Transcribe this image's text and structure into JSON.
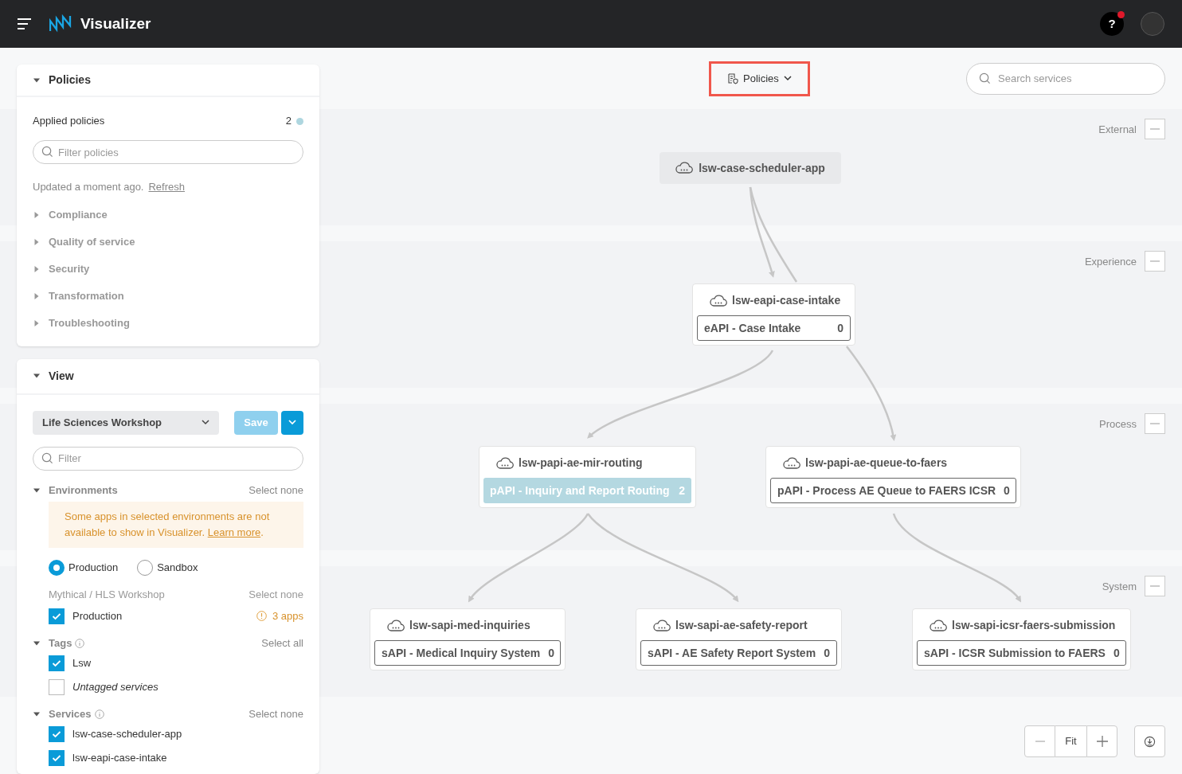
{
  "header": {
    "title": "Visualizer",
    "help_label": "?",
    "help_notification": true
  },
  "policies_panel": {
    "title": "Policies",
    "expanded": true,
    "applied_label": "Applied policies",
    "applied_count": "2",
    "filter_placeholder": "Filter policies",
    "updated_text": "Updated a moment ago.",
    "refresh_link": "Refresh",
    "categories": [
      {
        "label": "Compliance",
        "expanded": false
      },
      {
        "label": "Quality of service",
        "expanded": false
      },
      {
        "label": "Security",
        "expanded": false
      },
      {
        "label": "Transformation",
        "expanded": false
      },
      {
        "label": "Troubleshooting",
        "expanded": false
      }
    ]
  },
  "view_panel": {
    "title": "View",
    "expanded": true,
    "view_select": "Life Sciences Workshop",
    "save_button": {
      "label": "Save",
      "disabled": true
    },
    "filter_placeholder": "Filter",
    "environments": {
      "title": "Environments",
      "expanded": true,
      "action": "Select none",
      "notice": {
        "text": "Some apps in selected environments are not available to show in Visualizer.",
        "link": "Learn more",
        "suffix": "."
      },
      "types": [
        {
          "label": "Production",
          "selected": true
        },
        {
          "label": "Sandbox",
          "selected": false
        }
      ],
      "group": {
        "title": "Mythical / HLS Workshop",
        "action": "Select none",
        "items": [
          {
            "label": "Production",
            "checked": true,
            "warning": "3 apps"
          }
        ]
      }
    },
    "tags": {
      "title": "Tags",
      "expanded": true,
      "action": "Select all",
      "items": [
        {
          "label": "Lsw",
          "checked": true,
          "kind": "tag"
        },
        {
          "label": "Untagged services",
          "checked": false,
          "kind": "untagged"
        }
      ]
    },
    "services": {
      "title": "Services",
      "expanded": true,
      "action": "Select none",
      "items": [
        {
          "label": "lsw-case-scheduler-app",
          "checked": true
        },
        {
          "label": "lsw-eapi-case-intake",
          "checked": true
        }
      ]
    }
  },
  "toolbar": {
    "policies_button": "Policies",
    "search_placeholder": "Search services"
  },
  "lanes": [
    {
      "label": "External"
    },
    {
      "label": "Experience"
    },
    {
      "label": "Process"
    },
    {
      "label": "System"
    }
  ],
  "nodes": [
    {
      "name": "lsw-case-scheduler-app",
      "kind": "external"
    },
    {
      "name": "lsw-eapi-case-intake",
      "kind": "service",
      "api": {
        "label": "eAPI - Case Intake",
        "count": "0",
        "highlighted": false
      }
    },
    {
      "name": "lsw-papi-ae-mir-routing",
      "kind": "service",
      "api": {
        "label": "pAPI - Inquiry and Report Routing",
        "count": "2",
        "highlighted": true
      }
    },
    {
      "name": "lsw-papi-ae-queue-to-faers",
      "kind": "service",
      "api": {
        "label": "pAPI - Process AE Queue to FAERS ICSR",
        "count": "0",
        "highlighted": false
      }
    },
    {
      "name": "lsw-sapi-med-inquiries",
      "kind": "service",
      "api": {
        "label": "sAPI - Medical Inquiry System",
        "count": "0",
        "highlighted": false
      }
    },
    {
      "name": "lsw-sapi-ae-safety-report",
      "kind": "service",
      "api": {
        "label": "sAPI - AE Safety Report System",
        "count": "0",
        "highlighted": false
      }
    },
    {
      "name": "lsw-sapi-icsr-faers-submission",
      "kind": "service",
      "api": {
        "label": "sAPI - ICSR Submission to FAERS",
        "count": "0",
        "highlighted": false
      }
    }
  ],
  "zoom_controls": {
    "fit": "Fit"
  }
}
